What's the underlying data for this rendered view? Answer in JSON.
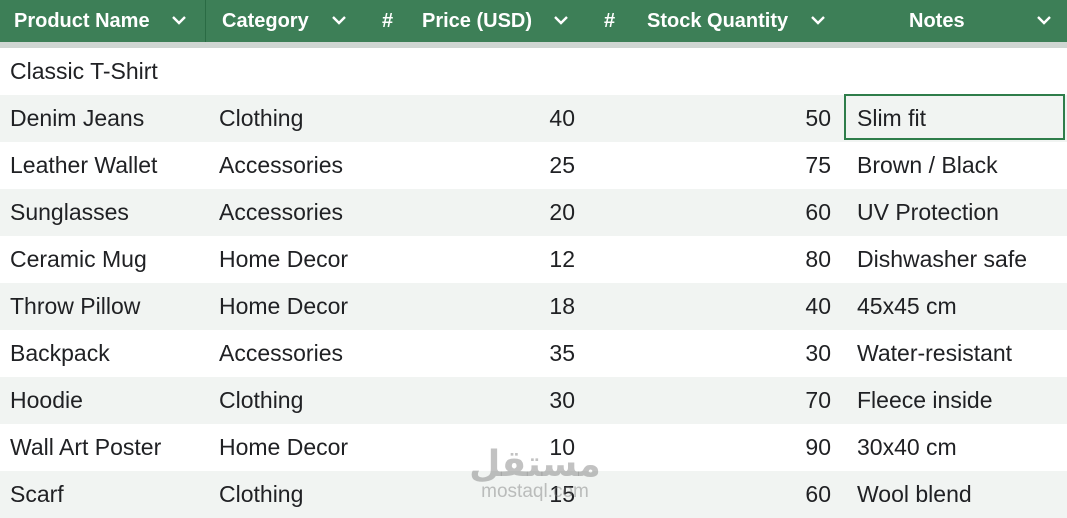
{
  "header": {
    "columns": [
      {
        "label": "Product Name"
      },
      {
        "label": "Category"
      },
      {
        "label": "Price (USD)",
        "number_marker": "#"
      },
      {
        "label": "Stock Quantity",
        "number_marker": "#"
      },
      {
        "label": "Notes"
      }
    ]
  },
  "rows": [
    {
      "product": "Classic T-Shirt",
      "category": "",
      "price": "",
      "stock": "",
      "notes": ""
    },
    {
      "product": "Denim Jeans",
      "category": "Clothing",
      "price": "40",
      "stock": "50",
      "notes": "Slim fit"
    },
    {
      "product": "Leather Wallet",
      "category": "Accessories",
      "price": "25",
      "stock": "75",
      "notes": "Brown / Black"
    },
    {
      "product": "Sunglasses",
      "category": "Accessories",
      "price": "20",
      "stock": "60",
      "notes": "UV Protection"
    },
    {
      "product": "Ceramic Mug",
      "category": "Home Decor",
      "price": "12",
      "stock": "80",
      "notes": "Dishwasher safe"
    },
    {
      "product": "Throw Pillow",
      "category": "Home Decor",
      "price": "18",
      "stock": "40",
      "notes": "45x45 cm"
    },
    {
      "product": "Backpack",
      "category": "Accessories",
      "price": "35",
      "stock": "30",
      "notes": "Water-resistant"
    },
    {
      "product": "Hoodie",
      "category": "Clothing",
      "price": "30",
      "stock": "70",
      "notes": "Fleece inside"
    },
    {
      "product": "Wall Art Poster",
      "category": "Home Decor",
      "price": "10",
      "stock": "90",
      "notes": "30x40 cm"
    },
    {
      "product": "Scarf",
      "category": "Clothing",
      "price": "15",
      "stock": "60",
      "notes": "Wool blend"
    }
  ],
  "selection": {
    "row": 1,
    "column": "notes"
  },
  "watermark": {
    "logo": "مستقل",
    "url": "mostaql.com"
  },
  "colors": {
    "header_bg": "#3d7f57",
    "header_text": "#ffffff",
    "row_alt": "#f1f4f2",
    "selection_border": "#2e7d4a"
  },
  "icons": {
    "column_menu": "chevron-down-icon"
  }
}
